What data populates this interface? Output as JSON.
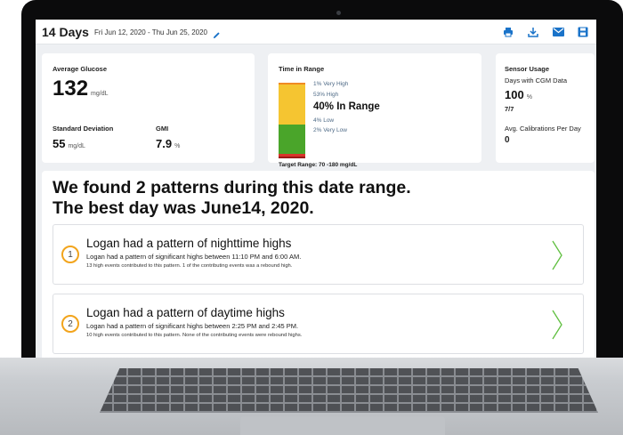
{
  "header": {
    "title": "14 Days",
    "date_range": "Fri Jun 12, 2020 - Thu Jun 25, 2020",
    "tools": [
      "print-icon",
      "download-icon",
      "email-icon",
      "save-icon"
    ],
    "accent": "#1a73c9"
  },
  "avg_glucose": {
    "label": "Average Glucose",
    "value": "132",
    "unit": "mg/dL",
    "sd_label": "Standard Deviation",
    "sd_value": "55",
    "sd_unit": "mg/dL",
    "gmi_label": "GMI",
    "gmi_value": "7.9",
    "gmi_unit": "%"
  },
  "time_in_range": {
    "label": "Time in Range",
    "very_high": "1% Very High",
    "high": "53% High",
    "in_range": "40% In Range",
    "low": "4% Low",
    "very_low": "2% Very Low",
    "target": "Target Range: 70 -180 mg/dL",
    "segments": [
      {
        "name": "very-high",
        "pct": 1,
        "color": "#f08a24"
      },
      {
        "name": "high",
        "pct": 53,
        "color": "#f5c531"
      },
      {
        "name": "in-range",
        "pct": 40,
        "color": "#4aa52a"
      },
      {
        "name": "low",
        "pct": 4,
        "color": "#d9342b"
      },
      {
        "name": "very-low",
        "pct": 2,
        "color": "#9c1a16"
      }
    ]
  },
  "sensor": {
    "label": "Sensor Usage",
    "days_label": "Days with CGM Data",
    "days_value": "100",
    "days_unit": "%",
    "days_fraction": "7/7",
    "cal_label": "Avg. Calibrations Per Day",
    "cal_value": "0"
  },
  "patterns": {
    "headline_1": "We found 2 patterns during this date range.",
    "headline_2": "The best day was June14, 2020.",
    "items": [
      {
        "num": "1",
        "title": "Logan had a pattern of nighttime highs",
        "sub": "Logan had a pattern of significant highs between 11:10 PM and 6:00 AM.",
        "note": "13 high events contributed to this pattern. 1 of the contributing events was a rebound high."
      },
      {
        "num": "2",
        "title": "Logan had a pattern of daytime highs",
        "sub": "Logan had a pattern of significant highs between 2:25 PM and 2:45 PM.",
        "note": "10 high events contributed to this pattern. None of the contributing events were rebound highs."
      }
    ],
    "number_color": "#f2a41c",
    "chevron_color": "#5fbf3f"
  }
}
